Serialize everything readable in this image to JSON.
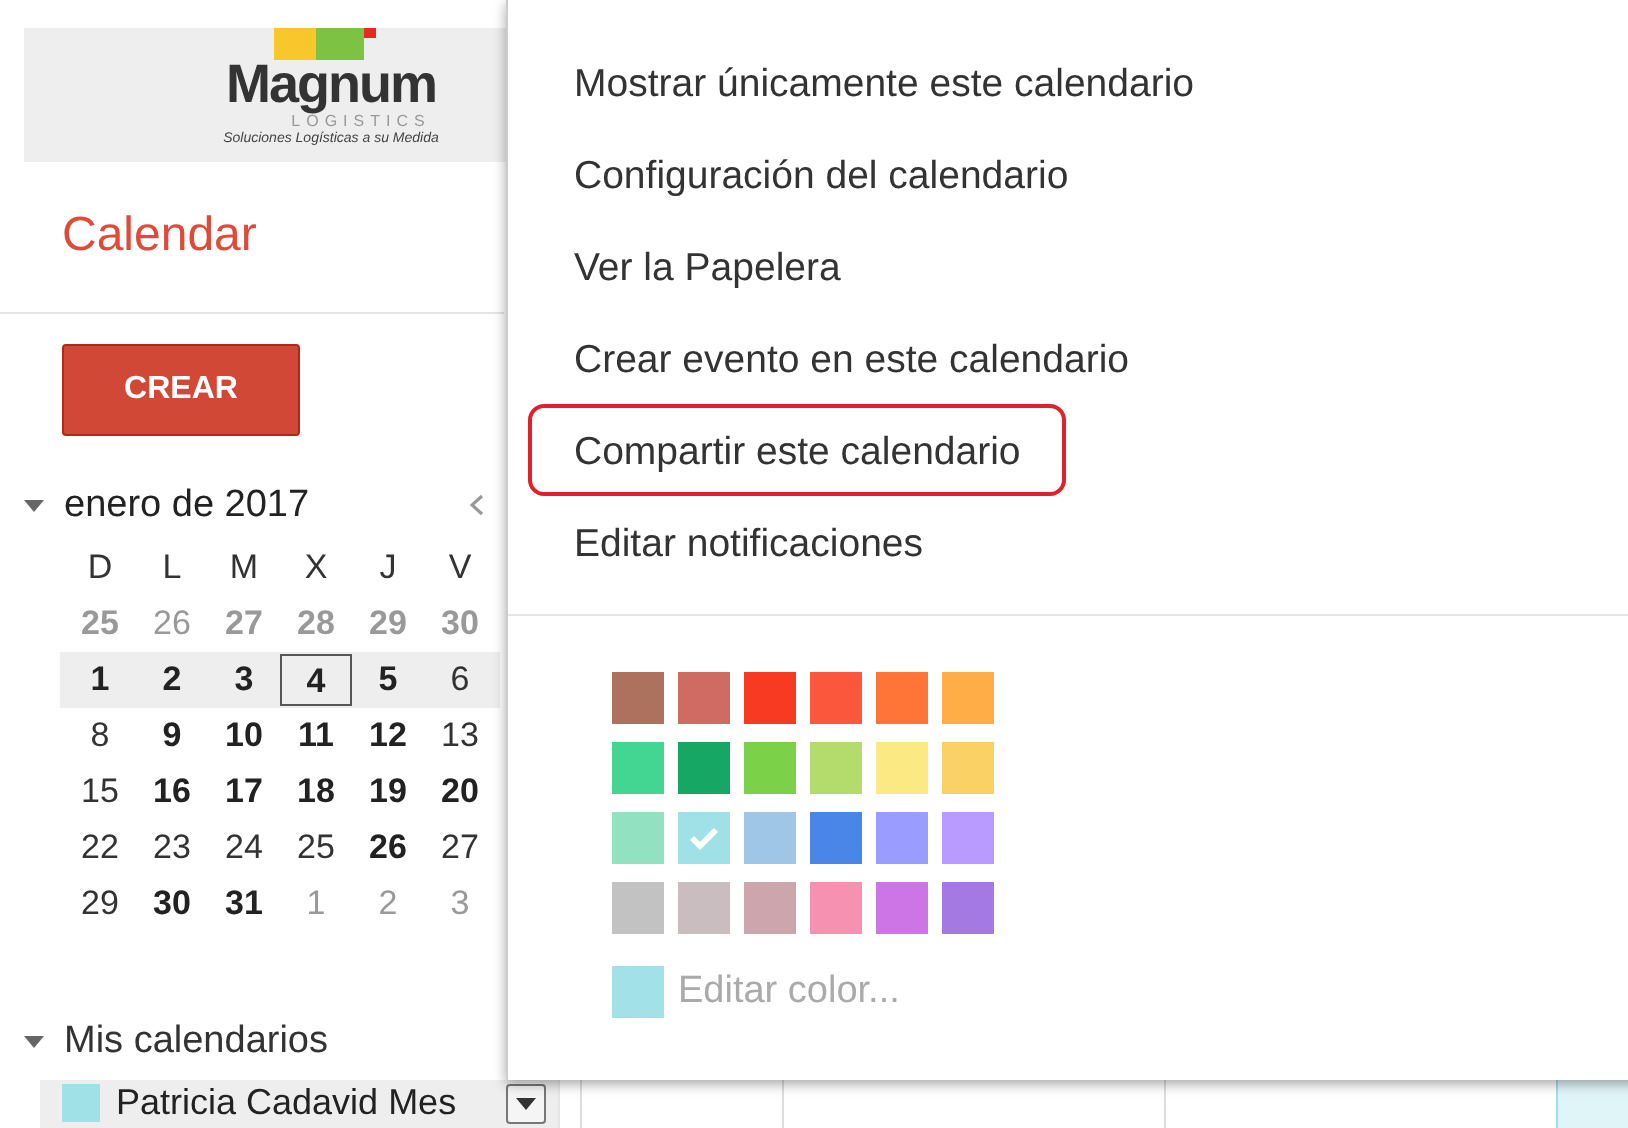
{
  "logo": {
    "name": "Magnum",
    "subtitle": "LOGISTICS",
    "tagline": "Soluciones Logísticas a su Medida"
  },
  "app_title": "Calendar",
  "create_button": "CREAR",
  "mini_calendar": {
    "month": "enero de 2017",
    "weekdays": [
      "D",
      "L",
      "M",
      "X",
      "J",
      "V"
    ],
    "weeks": [
      {
        "selected": false,
        "days": [
          {
            "label": "25",
            "bold": true,
            "other_month": true,
            "today": false
          },
          {
            "label": "26",
            "bold": false,
            "other_month": true,
            "today": false
          },
          {
            "label": "27",
            "bold": true,
            "other_month": true,
            "today": false
          },
          {
            "label": "28",
            "bold": true,
            "other_month": true,
            "today": false
          },
          {
            "label": "29",
            "bold": true,
            "other_month": true,
            "today": false
          },
          {
            "label": "30",
            "bold": true,
            "other_month": true,
            "today": false
          }
        ]
      },
      {
        "selected": true,
        "days": [
          {
            "label": "1",
            "bold": true,
            "other_month": false,
            "today": false
          },
          {
            "label": "2",
            "bold": true,
            "other_month": false,
            "today": false
          },
          {
            "label": "3",
            "bold": true,
            "other_month": false,
            "today": false
          },
          {
            "label": "4",
            "bold": true,
            "other_month": false,
            "today": true
          },
          {
            "label": "5",
            "bold": true,
            "other_month": false,
            "today": false
          },
          {
            "label": "6",
            "bold": false,
            "other_month": false,
            "today": false
          }
        ]
      },
      {
        "selected": false,
        "days": [
          {
            "label": "8",
            "bold": false,
            "other_month": false,
            "today": false
          },
          {
            "label": "9",
            "bold": true,
            "other_month": false,
            "today": false
          },
          {
            "label": "10",
            "bold": true,
            "other_month": false,
            "today": false
          },
          {
            "label": "11",
            "bold": true,
            "other_month": false,
            "today": false
          },
          {
            "label": "12",
            "bold": true,
            "other_month": false,
            "today": false
          },
          {
            "label": "13",
            "bold": false,
            "other_month": false,
            "today": false
          }
        ]
      },
      {
        "selected": false,
        "days": [
          {
            "label": "15",
            "bold": false,
            "other_month": false,
            "today": false
          },
          {
            "label": "16",
            "bold": true,
            "other_month": false,
            "today": false
          },
          {
            "label": "17",
            "bold": true,
            "other_month": false,
            "today": false
          },
          {
            "label": "18",
            "bold": true,
            "other_month": false,
            "today": false
          },
          {
            "label": "19",
            "bold": true,
            "other_month": false,
            "today": false
          },
          {
            "label": "20",
            "bold": true,
            "other_month": false,
            "today": false
          }
        ]
      },
      {
        "selected": false,
        "days": [
          {
            "label": "22",
            "bold": false,
            "other_month": false,
            "today": false
          },
          {
            "label": "23",
            "bold": false,
            "other_month": false,
            "today": false
          },
          {
            "label": "24",
            "bold": false,
            "other_month": false,
            "today": false
          },
          {
            "label": "25",
            "bold": false,
            "other_month": false,
            "today": false
          },
          {
            "label": "26",
            "bold": true,
            "other_month": false,
            "today": false
          },
          {
            "label": "27",
            "bold": false,
            "other_month": false,
            "today": false
          }
        ]
      },
      {
        "selected": false,
        "days": [
          {
            "label": "29",
            "bold": false,
            "other_month": false,
            "today": false
          },
          {
            "label": "30",
            "bold": true,
            "other_month": false,
            "today": false
          },
          {
            "label": "31",
            "bold": true,
            "other_month": false,
            "today": false
          },
          {
            "label": "1",
            "bold": false,
            "other_month": true,
            "today": false
          },
          {
            "label": "2",
            "bold": false,
            "other_month": true,
            "today": false
          },
          {
            "label": "3",
            "bold": false,
            "other_month": true,
            "today": false
          }
        ]
      }
    ]
  },
  "my_calendars": {
    "title": "Mis calendarios",
    "items": [
      {
        "name": "Patricia Cadavid Mes",
        "color": "#9fe1e7",
        "selected": true
      }
    ]
  },
  "menu": {
    "items": [
      {
        "label": "Mostrar únicamente este calendario",
        "highlighted": false
      },
      {
        "label": "Configuración del calendario",
        "highlighted": false
      },
      {
        "label": "Ver la Papelera",
        "highlighted": false
      },
      {
        "label": "Crear evento en este calendario",
        "highlighted": false
      },
      {
        "label": "Compartir este calendario",
        "highlighted": true
      },
      {
        "label": "Editar notificaciones",
        "highlighted": false
      }
    ],
    "swatches": [
      {
        "color": "#ac725e",
        "checked": false
      },
      {
        "color": "#d06b64",
        "checked": false
      },
      {
        "color": "#f83a22",
        "checked": false
      },
      {
        "color": "#fa573c",
        "checked": false
      },
      {
        "color": "#ff7537",
        "checked": false
      },
      {
        "color": "#ffad46",
        "checked": false
      },
      {
        "color": "#42d692",
        "checked": false
      },
      {
        "color": "#16a765",
        "checked": false
      },
      {
        "color": "#7bd148",
        "checked": false
      },
      {
        "color": "#b3dc6c",
        "checked": false
      },
      {
        "color": "#fbe983",
        "checked": false
      },
      {
        "color": "#fad165",
        "checked": false
      },
      {
        "color": "#92e1c0",
        "checked": false
      },
      {
        "color": "#9fe1e7",
        "checked": true
      },
      {
        "color": "#9fc6e7",
        "checked": false
      },
      {
        "color": "#4986e7",
        "checked": false
      },
      {
        "color": "#9a9cff",
        "checked": false
      },
      {
        "color": "#b99aff",
        "checked": false
      },
      {
        "color": "#c2c2c2",
        "checked": false
      },
      {
        "color": "#cabdbf",
        "checked": false
      },
      {
        "color": "#cca6ac",
        "checked": false
      },
      {
        "color": "#f691b2",
        "checked": false
      },
      {
        "color": "#cd74e6",
        "checked": false
      },
      {
        "color": "#a47ae2",
        "checked": false
      }
    ],
    "custom_color": {
      "label": "Editar color...",
      "color": "#a2e1e8"
    }
  }
}
